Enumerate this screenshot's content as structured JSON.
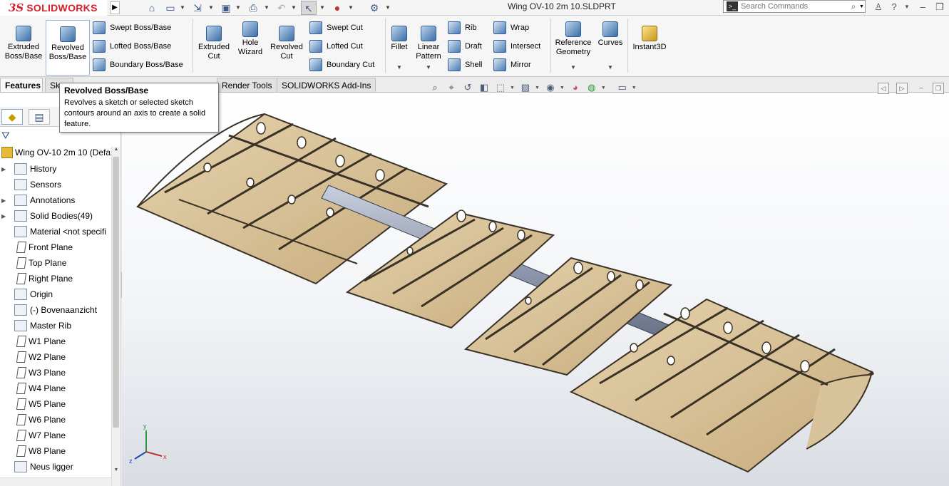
{
  "titlebar": {
    "logo_ds": "3S",
    "logo_name": "SOLIDWORKS",
    "document_title": "Wing OV-10 2m 10.SLDPRT",
    "search_placeholder": "Search Commands",
    "quick_access": [
      "home-icon",
      "new-document-icon",
      "open-icon",
      "save-icon",
      "print-icon",
      "undo-icon",
      "select-icon",
      "rebuild-icon",
      "options-icon"
    ]
  },
  "command_manager": {
    "extruded_boss": "Extruded\nBoss/Base",
    "revolved_boss": "Revolved\nBoss/Base",
    "swept_boss": "Swept Boss/Base",
    "lofted_boss": "Lofted Boss/Base",
    "boundary_boss": "Boundary Boss/Base",
    "extruded_cut": "Extruded\nCut",
    "hole_wizard": "Hole\nWizard",
    "revolved_cut": "Revolved\nCut",
    "swept_cut": "Swept Cut",
    "lofted_cut": "Lofted Cut",
    "boundary_cut": "Boundary Cut",
    "fillet": "Fillet",
    "linear_pattern": "Linear\nPattern",
    "rib": "Rib",
    "draft": "Draft",
    "shell": "Shell",
    "wrap": "Wrap",
    "intersect": "Intersect",
    "mirror": "Mirror",
    "reference_geometry": "Reference\nGeometry",
    "curves": "Curves",
    "instant3d": "Instant3D"
  },
  "tabs": [
    {
      "label": "Features",
      "active": true
    },
    {
      "label": "Sk",
      "active": false
    },
    {
      "label": "Render Tools",
      "active": false
    },
    {
      "label": "SOLIDWORKS Add-Ins",
      "active": false
    }
  ],
  "tooltip": {
    "title": "Revolved Boss/Base",
    "body": "Revolves a sketch or selected sketch contours around an axis to create a solid feature."
  },
  "feature_manager": {
    "root": "Wing OV-10 2m 10  (Defa",
    "items": [
      {
        "label": "History",
        "icon": "history-icon",
        "expandable": true
      },
      {
        "label": "Sensors",
        "icon": "sensors-icon",
        "expandable": false
      },
      {
        "label": "Annotations",
        "icon": "annotations-icon",
        "expandable": true
      },
      {
        "label": "Solid Bodies(49)",
        "icon": "solid-bodies-icon",
        "expandable": true
      },
      {
        "label": "Material <not specifi",
        "icon": "material-icon",
        "expandable": false
      },
      {
        "label": "Front Plane",
        "icon": "plane-icon",
        "expandable": false
      },
      {
        "label": "Top Plane",
        "icon": "plane-icon",
        "expandable": false
      },
      {
        "label": "Right Plane",
        "icon": "plane-icon",
        "expandable": false
      },
      {
        "label": "Origin",
        "icon": "origin-icon",
        "expandable": false
      },
      {
        "label": "(-) Bovenaanzicht",
        "icon": "sketch-icon",
        "expandable": false
      },
      {
        "label": "Master Rib",
        "icon": "sketch-icon",
        "expandable": false
      },
      {
        "label": "W1 Plane",
        "icon": "plane-icon",
        "expandable": false
      },
      {
        "label": "W2 Plane",
        "icon": "plane-icon",
        "expandable": false
      },
      {
        "label": "W3 Plane",
        "icon": "plane-icon",
        "expandable": false
      },
      {
        "label": "W4 Plane",
        "icon": "plane-icon",
        "expandable": false
      },
      {
        "label": "W5 Plane",
        "icon": "plane-icon",
        "expandable": false
      },
      {
        "label": "W6 Plane",
        "icon": "plane-icon",
        "expandable": false
      },
      {
        "label": "W7 Plane",
        "icon": "plane-icon",
        "expandable": false
      },
      {
        "label": "W8 Plane",
        "icon": "plane-icon",
        "expandable": false
      },
      {
        "label": "Neus ligger",
        "icon": "sketch-icon",
        "expandable": false
      }
    ]
  },
  "triad": {
    "x": "x",
    "y": "y",
    "z": "z"
  },
  "colors": {
    "wood": "#d8c29a",
    "wood_dark": "#a88a5c",
    "rib_edge": "#3a3226",
    "tube": "#8c95aa",
    "brand_red": "#d6202b"
  }
}
